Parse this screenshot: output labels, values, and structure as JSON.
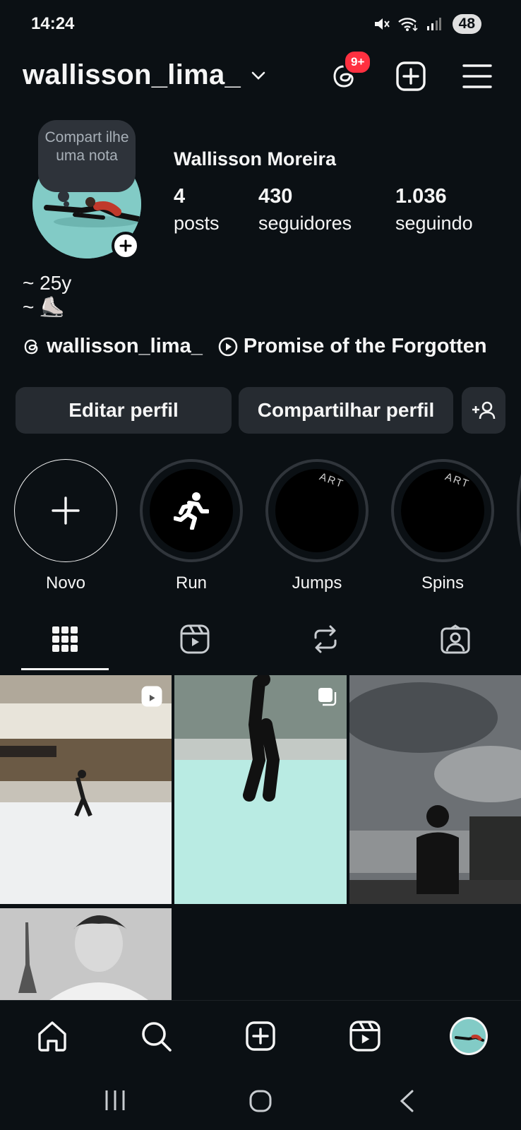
{
  "status_bar": {
    "time": "14:24",
    "battery": "48"
  },
  "header": {
    "username": "wallisson_lima_",
    "threads_badge": "9+"
  },
  "profile": {
    "note_text": "Compart ilhe uma nota",
    "full_name": "Wallisson Moreira",
    "stats": [
      {
        "value": "4",
        "label": "posts"
      },
      {
        "value": "430",
        "label": "seguidores"
      },
      {
        "value": "1.036",
        "label": "seguindo"
      }
    ],
    "bio_line1": "~ 25y",
    "bio_line2": "~ ⛸️",
    "threads_link": "wallisson_lima_",
    "music": "Promise of the Forgotten"
  },
  "buttons": {
    "edit": "Editar perfil",
    "share": "Compartilhar perfil"
  },
  "highlights": [
    {
      "label": "Novo",
      "art": ""
    },
    {
      "label": "Run",
      "art": ""
    },
    {
      "label": "Jumps",
      "art": "ART"
    },
    {
      "label": "Spins",
      "art": "ART"
    }
  ],
  "colors": {
    "background": "#0b1014",
    "button": "#262b31",
    "badge": "#ff3040",
    "accent_teal": "#7fc9c4"
  }
}
